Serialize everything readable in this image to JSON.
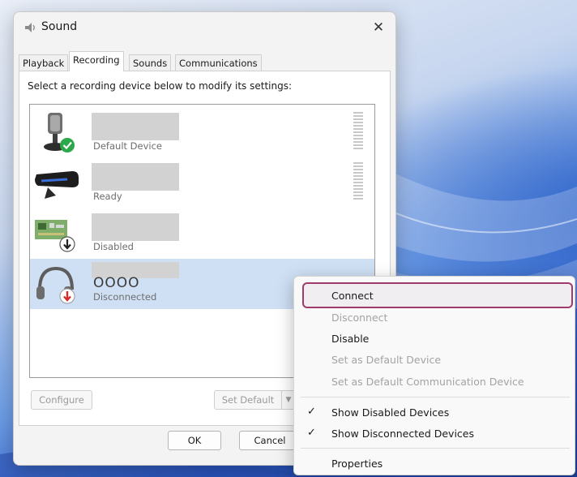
{
  "window": {
    "title": "Sound",
    "close_glyph": "✕"
  },
  "tabs": [
    {
      "label": "Playback"
    },
    {
      "label": "Recording"
    },
    {
      "label": "Sounds"
    },
    {
      "label": "Communications"
    }
  ],
  "active_tab": "Recording",
  "instruction": "Select a recording device below to modify its settings:",
  "devices": [
    {
      "status": "Default Device",
      "icon": "microphone-icon",
      "badge": "default-check-icon"
    },
    {
      "status": "Ready",
      "icon": "webcam-icon"
    },
    {
      "status": "Disabled",
      "icon": "line-in-card-icon",
      "badge": "disabled-arrow-icon"
    },
    {
      "name": "OOOO",
      "status": "Disconnected",
      "icon": "headset-icon",
      "badge": "disconnected-arrow-icon",
      "selected": true
    }
  ],
  "buttons": {
    "configure": "Configure",
    "set_default": "Set Default",
    "set_default_arrow": "▼",
    "ok": "OK",
    "cancel": "Cancel"
  },
  "context_menu": {
    "items": [
      {
        "label": "Connect",
        "enabled": true,
        "highlighted": true
      },
      {
        "label": "Disconnect",
        "enabled": false
      },
      {
        "label": "Disable",
        "enabled": true
      },
      {
        "label": "Set as Default Device",
        "enabled": false
      },
      {
        "label": "Set as Default Communication Device",
        "enabled": false
      },
      {
        "label": "Show Disabled Devices",
        "enabled": true,
        "checked": true
      },
      {
        "label": "Show Disconnected Devices",
        "enabled": true,
        "checked": true
      },
      {
        "label": "Properties",
        "enabled": true
      }
    ],
    "check_glyph": "✓"
  },
  "colors": {
    "highlight_border": "#a23a6b",
    "selected_row": "#cfe0f4",
    "default_badge": "#2aa84a",
    "disconnected_badge": "#d42a2a"
  }
}
